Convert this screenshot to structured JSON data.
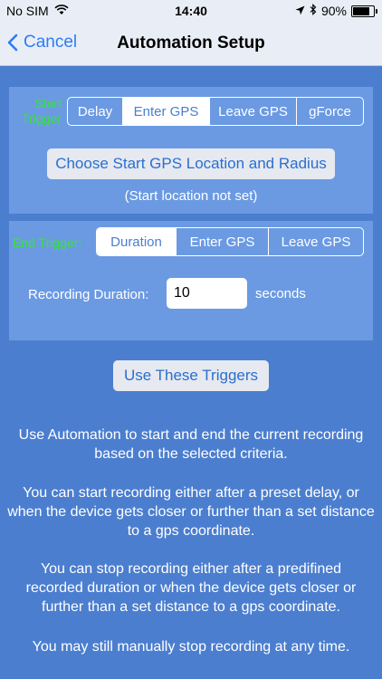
{
  "status": {
    "carrier": "No SIM",
    "time": "14:40",
    "battery": "90%",
    "battery_level": 0.9
  },
  "nav": {
    "back_label": "Cancel",
    "title": "Automation Setup"
  },
  "start_trigger": {
    "label": "Start Trigger",
    "segments": [
      "Delay",
      "Enter GPS",
      "Leave GPS",
      "gForce"
    ],
    "selected_index": 1,
    "choose_button": "Choose Start GPS Location and Radius",
    "location_status": "(Start location not set)"
  },
  "end_trigger": {
    "label": "End Trigger:",
    "segments": [
      "Duration",
      "Enter GPS",
      "Leave GPS"
    ],
    "selected_index": 0,
    "duration_label": "Recording Duration:",
    "duration_value": "10",
    "duration_unit": "seconds"
  },
  "use_button": "Use These Triggers",
  "info": {
    "p1": "Use Automation to start and end the current recording based on the selected criteria.",
    "p2": "You can start recording either after a preset delay, or when the device gets closer or further than a set distance to a gps coordinate.",
    "p3": "You can stop recording either after a predifined recorded duration or when the device gets closer or further than a set distance to a gps coordinate.",
    "p4": "You may still manually stop recording at any time."
  },
  "colors": {
    "background": "#4b7ecf",
    "panel": "#6b9ae3",
    "trigger_label": "#33e633",
    "link_blue": "#2f7bf5"
  }
}
